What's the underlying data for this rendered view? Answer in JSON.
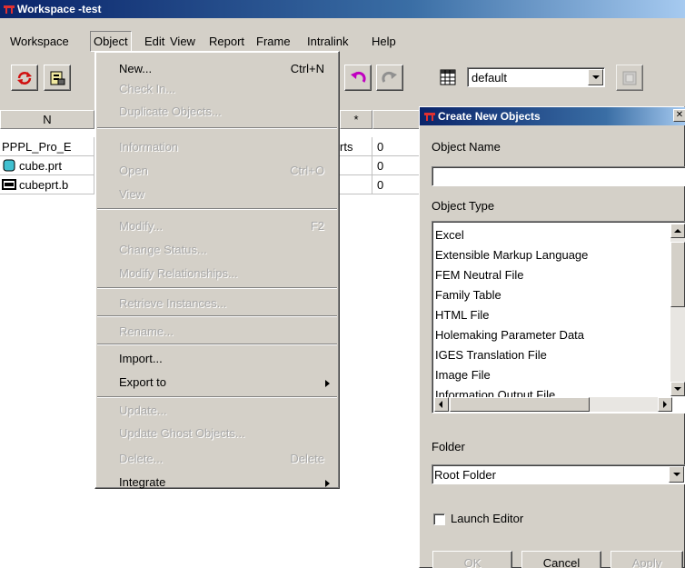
{
  "window": {
    "title": "Workspace -test"
  },
  "menubar": [
    "Workspace",
    "Object",
    "Edit",
    "View",
    "Report",
    "Frame",
    "Intralink",
    "Help"
  ],
  "toolbar": {
    "icons": [
      "refresh-icon",
      "check-in-icon",
      "undo-icon",
      "redo-icon",
      "table-view-icon",
      "layout-icon"
    ],
    "view_select": "default"
  },
  "table": {
    "headers": [
      "N",
      "*",
      ""
    ],
    "rows": [
      {
        "name": "PPPL_Pro_E",
        "col2": "rts",
        "col3": "0"
      },
      {
        "name": "cube.prt",
        "col2": "",
        "col3": "0"
      },
      {
        "name": "cubeprt.b",
        "col2": "",
        "col3": "0"
      }
    ]
  },
  "object_menu": {
    "items": [
      {
        "label": "New...",
        "accel": "Ctrl+N",
        "enabled": true
      },
      {
        "label": "Check In...",
        "accel": "",
        "enabled": false
      },
      {
        "label": "Duplicate Objects...",
        "accel": "",
        "enabled": false
      },
      {
        "label": "Information",
        "accel": "",
        "enabled": false
      },
      {
        "label": "Open",
        "accel": "Ctrl+O",
        "enabled": false
      },
      {
        "label": "View",
        "accel": "",
        "enabled": false
      },
      {
        "label": "Modify...",
        "accel": "F2",
        "enabled": false
      },
      {
        "label": "Change Status...",
        "accel": "",
        "enabled": false
      },
      {
        "label": "Modify Relationships...",
        "accel": "",
        "enabled": false
      },
      {
        "label": "Retrieve Instances...",
        "accel": "",
        "enabled": false
      },
      {
        "label": "Rename...",
        "accel": "",
        "enabled": false
      },
      {
        "label": "Import...",
        "accel": "",
        "enabled": true
      },
      {
        "label": "Export to",
        "accel": "",
        "enabled": true
      },
      {
        "label": "Update...",
        "accel": "",
        "enabled": false
      },
      {
        "label": "Update Ghost Objects...",
        "accel": "",
        "enabled": false
      },
      {
        "label": "Delete...",
        "accel": "Delete",
        "enabled": false
      },
      {
        "label": "Integrate",
        "accel": "",
        "enabled": true
      }
    ]
  },
  "dialog": {
    "title": "Create New Objects",
    "object_name_label": "Object Name",
    "object_name_value": "",
    "object_type_label": "Object Type",
    "object_types": [
      "Excel",
      "Extensible Markup Language",
      "FEM Neutral File",
      "Family Table",
      "HTML File",
      "Holemaking Parameter Data",
      "IGES Translation File",
      "Image File",
      "Information Output File"
    ],
    "folder_label": "Folder",
    "folder_value": "Root Folder",
    "launch_editor_label": "Launch Editor",
    "launch_editor_checked": false,
    "buttons": {
      "ok": "OK",
      "cancel": "Cancel",
      "apply": "Apply"
    }
  },
  "colors": {
    "titlebar": "#0a246a",
    "chrome": "#d4d0c8",
    "disabled_text": "#a8a8a8"
  }
}
